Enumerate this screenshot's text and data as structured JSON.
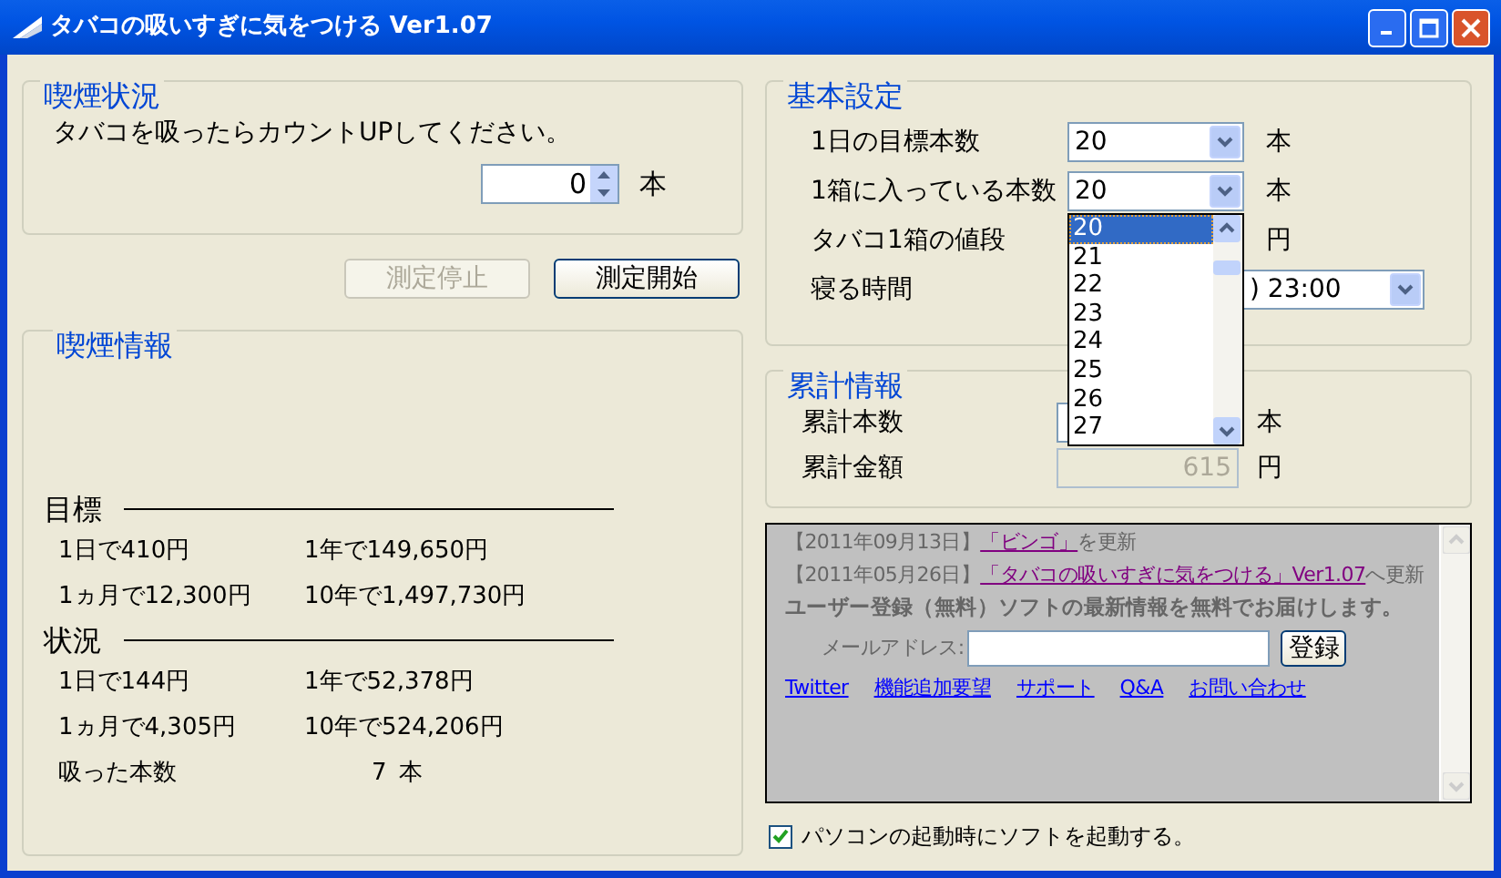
{
  "window": {
    "title": "タバコの吸いすぎに気をつける Ver1.07"
  },
  "smoking_status": {
    "title": "喫煙状況",
    "instruction": "タバコを吸ったらカウントUPしてください。",
    "count": {
      "value": "0",
      "unit": "本"
    }
  },
  "buttons": [
    {
      "label": "測定停止",
      "disabled": true
    },
    {
      "label": "測定開始",
      "disabled": false
    }
  ],
  "smoking_info": {
    "title": "喫煙情報",
    "sections": [
      {
        "heading": "目標",
        "rows": [
          [
            "1日で410円",
            "1年で149,650円"
          ],
          [
            "1ヵ月で12,300円",
            "10年で1,497,730円"
          ]
        ]
      },
      {
        "heading": "状況",
        "rows": [
          [
            "1日で144円",
            "1年で52,378円"
          ],
          [
            "1ヵ月で4,305円",
            "10年で524,206円"
          ]
        ]
      }
    ],
    "smoked": {
      "label": "吸った本数",
      "value": "7",
      "unit": "本"
    }
  },
  "basic_settings": {
    "title": "基本設定",
    "fields": [
      {
        "kind": "combo",
        "label": "1日の目標本数",
        "value": "20",
        "unit": "本"
      },
      {
        "kind": "combo",
        "label": "1箱に入っている本数",
        "value": "20",
        "unit": "本",
        "expanded": true,
        "options": [
          {
            "label": "20",
            "selected": true
          },
          {
            "label": "21",
            "selected": false
          },
          {
            "label": "22",
            "selected": false
          },
          {
            "label": "23",
            "selected": false
          },
          {
            "label": "24",
            "selected": false
          },
          {
            "label": "25",
            "selected": false
          },
          {
            "label": "26",
            "selected": false
          },
          {
            "label": "27",
            "selected": false
          }
        ]
      },
      {
        "kind": "covered",
        "label": "タバコ1箱の値段",
        "unit": "円"
      },
      {
        "kind": "wide-combo",
        "label": "寝る時間",
        "value": ") 23:00"
      }
    ]
  },
  "totals": {
    "title": "累計情報",
    "fields": [
      {
        "label": "累計本数",
        "unit": "本",
        "disabled": false
      },
      {
        "label": "累計金額",
        "value": "615",
        "unit": "円",
        "disabled": true
      }
    ]
  },
  "web_panel": {
    "news": [
      {
        "date": "【2011年09月13日】",
        "link": "「ビンゴ」",
        "suffix": "を更新"
      },
      {
        "date": "【2011年05月26日】",
        "link": "「タバコの吸いすぎに気をつける」Ver1.07",
        "suffix": "へ更新"
      }
    ],
    "promo": "ユーザー登録（無料）ソフトの最新情報を無料でお届けします。",
    "email_label": "メールアドレス:",
    "register_button": "登録",
    "links": [
      "Twitter",
      "機能追加要望",
      "サポート",
      "Q&A",
      "お問い合わせ"
    ]
  },
  "startup_checkbox": {
    "label": "パソコンの起動時にソフトを起動する。",
    "checked": true
  }
}
